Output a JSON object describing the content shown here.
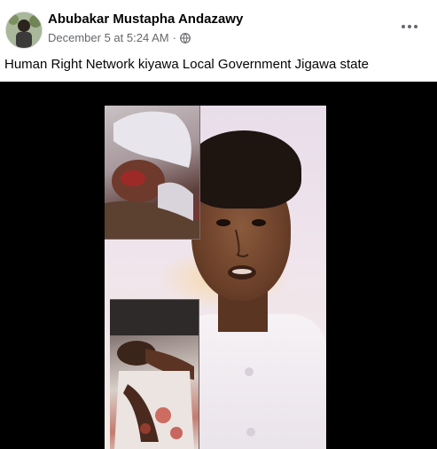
{
  "post": {
    "author": "Abubakar Mustapha Andazawy",
    "date": "December 5 at 5:24 AM",
    "separator": "·",
    "audience_icon": "globe-icon",
    "more_icon": "more-options-icon",
    "caption": "Human Right Network kiyawa Local Government Jigawa state"
  },
  "colors": {
    "text": "#050505",
    "meta": "#65676b",
    "media_bg": "#000000"
  }
}
